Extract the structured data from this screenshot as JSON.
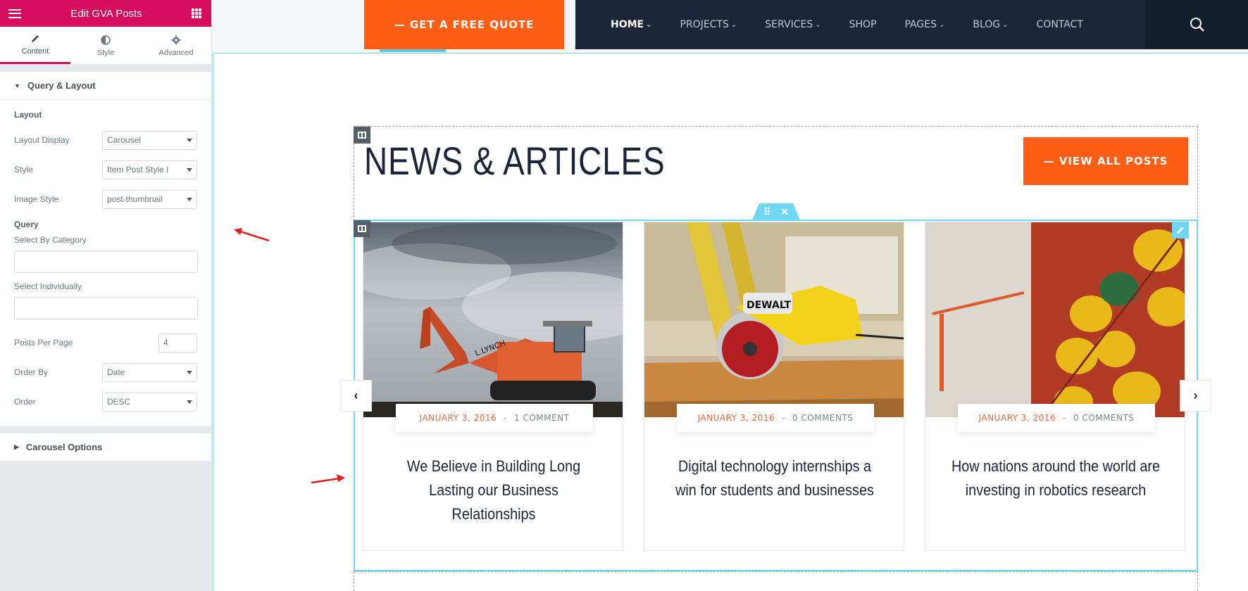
{
  "panel": {
    "title": "Edit GVA Posts",
    "tabs": [
      {
        "label": "Content",
        "icon": "pencil-icon"
      },
      {
        "label": "Style",
        "icon": "half-circle-icon"
      },
      {
        "label": "Advanced",
        "icon": "gear-icon"
      }
    ],
    "query_layout_title": "Query & Layout",
    "layout_group": "Layout",
    "layout_display_label": "Layout Display",
    "layout_display_value": "Carousel",
    "style_label": "Style",
    "style_value": "Item Post Style I",
    "image_style_label": "Image Style",
    "image_style_value": "post-thumbnail",
    "query_group": "Query",
    "select_by_category_label": "Select By Category",
    "select_individually_label": "Select Individually",
    "posts_per_page_label": "Posts Per Page",
    "posts_per_page_value": "4",
    "order_by_label": "Order By",
    "order_by_value": "Date",
    "order_label": "Order",
    "order_value": "DESC",
    "carousel_options_title": "Carousel Options"
  },
  "header": {
    "quote_button": "— GET A FREE QUOTE",
    "nav": [
      "HOME",
      "PROJECTS",
      "SERVICES",
      "SHOP",
      "PAGES",
      "BLOG",
      "CONTACT"
    ]
  },
  "section": {
    "heading": "NEWS & ARTICLES",
    "view_all": "— VIEW ALL POSTS"
  },
  "posts": [
    {
      "date": "JANUARY 3, 2016",
      "sep": "-",
      "comments": "1 COMMENT",
      "title": "We Believe in Building Long Lasting our Business Relationships",
      "image": "excavator-image"
    },
    {
      "date": "JANUARY 3, 2016",
      "sep": "-",
      "comments": "0 COMMENTS",
      "title": "Digital technology internships a win for students and businesses",
      "image": "circular-saw-image"
    },
    {
      "date": "JANUARY 3, 2016",
      "sep": "-",
      "comments": "0 COMMENTS",
      "title": "How nations around the world are investing in robotics research",
      "image": "hard-hats-image"
    }
  ],
  "colors": {
    "brand": "#d30c5c",
    "accent": "#ff5e14",
    "navbar": "#1a2538",
    "selection": "#71d7f7"
  }
}
